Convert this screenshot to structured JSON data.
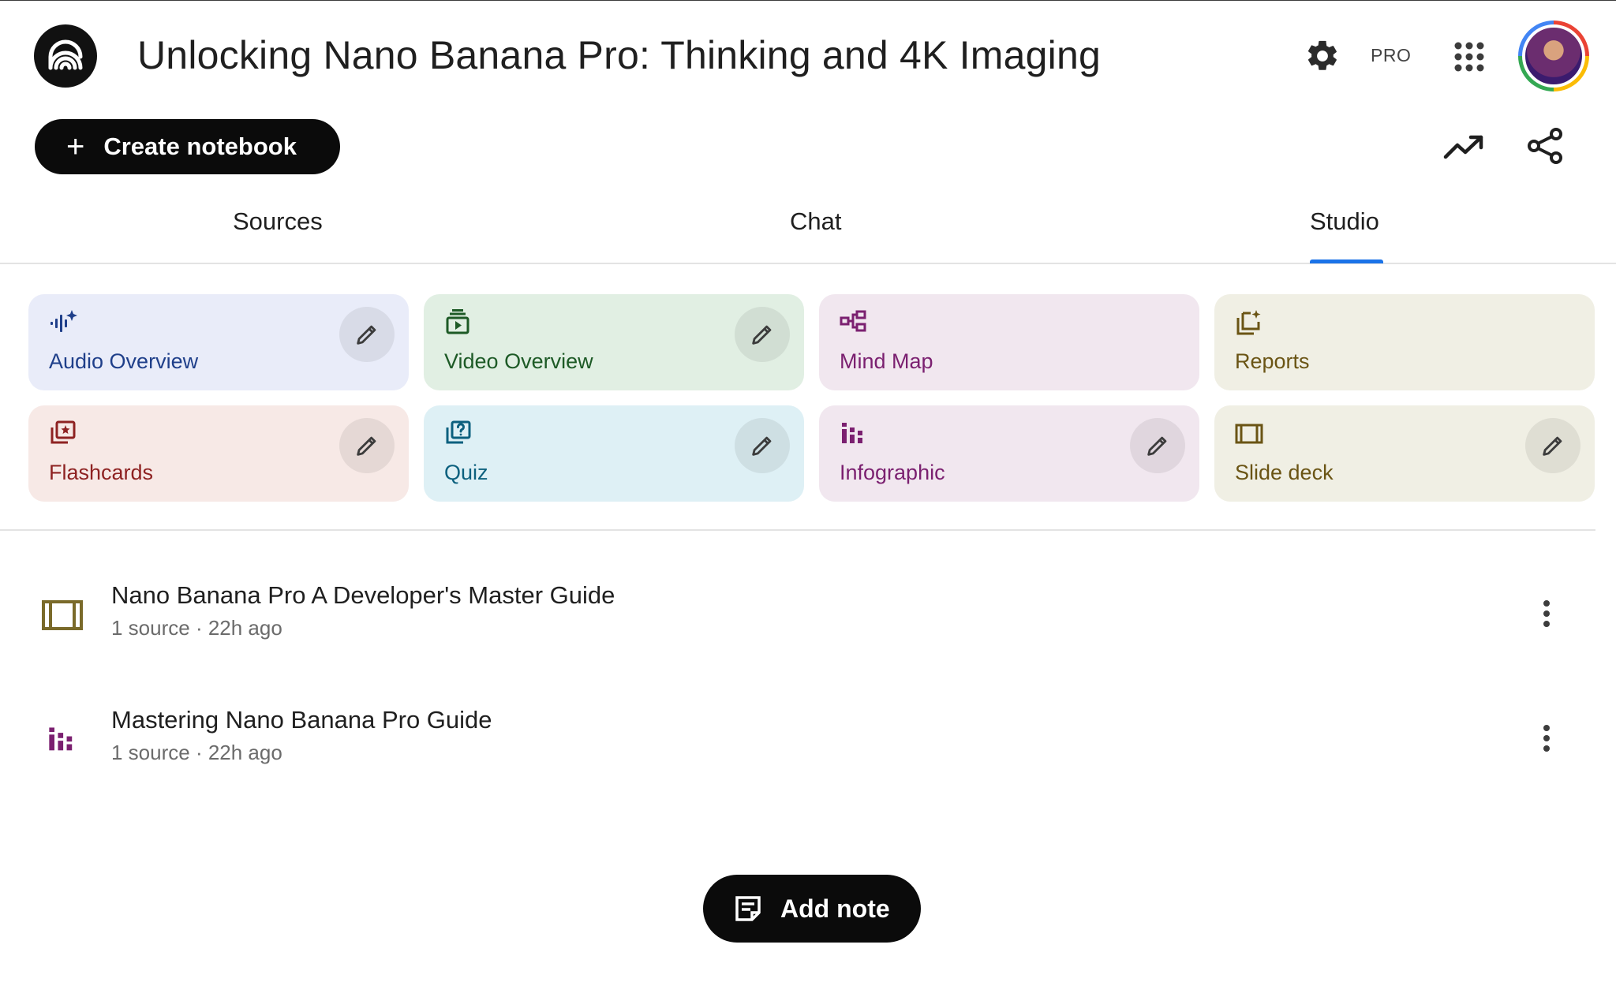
{
  "header": {
    "logo_icon": "notebooklm-logo-icon",
    "title": "Unlocking Nano Banana Pro: Thinking and 4K Imaging",
    "settings_icon": "gear-icon",
    "plan_label": "PRO",
    "apps_icon": "apps-grid-icon",
    "avatar_icon": "user-avatar"
  },
  "toolbar": {
    "create_label": "Create notebook",
    "analytics_icon": "trending-up-icon",
    "share_icon": "share-icon"
  },
  "tabs": [
    {
      "label": "Sources",
      "active": false
    },
    {
      "label": "Chat",
      "active": false
    },
    {
      "label": "Studio",
      "active": true
    }
  ],
  "studio": {
    "cards": [
      {
        "label": "Audio Overview",
        "icon": "audio-waveform-icon",
        "editable": true,
        "color": "#1f3f8a"
      },
      {
        "label": "Video Overview",
        "icon": "video-player-icon",
        "editable": true,
        "color": "#1d5a26"
      },
      {
        "label": "Mind Map",
        "icon": "mind-map-icon",
        "editable": false,
        "color": "#7b2070"
      },
      {
        "label": "Reports",
        "icon": "reports-icon",
        "editable": false,
        "color": "#6a5414"
      },
      {
        "label": "Flashcards",
        "icon": "flashcards-icon",
        "editable": true,
        "color": "#8e2222"
      },
      {
        "label": "Quiz",
        "icon": "quiz-icon",
        "editable": true,
        "color": "#0c607e"
      },
      {
        "label": "Infographic",
        "icon": "infographic-icon",
        "editable": true,
        "color": "#7b2070"
      },
      {
        "label": "Slide deck",
        "icon": "slide-deck-icon",
        "editable": true,
        "color": "#6a5414"
      }
    ]
  },
  "notes": [
    {
      "title": "Nano Banana Pro A Developer's Master Guide",
      "meta": "1 source · 22h ago",
      "icon": "slide-deck-icon",
      "color": "#7a6a2a"
    },
    {
      "title": "Mastering Nano Banana Pro Guide",
      "meta": "1 source · 22h ago",
      "icon": "infographic-icon",
      "color": "#7b2070"
    }
  ],
  "footer": {
    "add_note_label": "Add note",
    "add_note_icon": "note-icon"
  }
}
